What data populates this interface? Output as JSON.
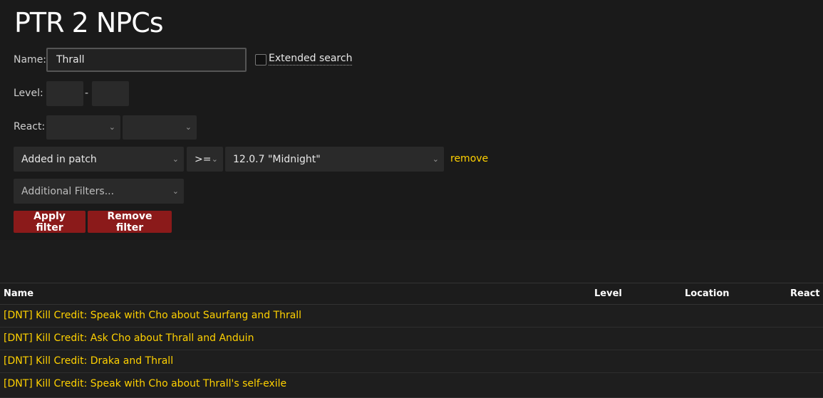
{
  "page": {
    "title": "PTR 2 NPCs"
  },
  "filters": {
    "name_label": "Name:",
    "name_value": "Thrall",
    "extended_search_label": "Extended search",
    "level_label": "Level:",
    "level_min": "",
    "level_max": "",
    "level_separator": "-",
    "react_label": "React:",
    "react_1": "",
    "react_2": "",
    "criteria": {
      "field": "Added in patch",
      "operator": ">=",
      "value": "12.0.7 \"Midnight\"",
      "remove_label": "remove"
    },
    "additional_filters": "Additional Filters...",
    "apply_label": "Apply filter",
    "clear_label": "Remove filter"
  },
  "table": {
    "columns": [
      "Name",
      "Level",
      "Location",
      "React"
    ],
    "rows": [
      {
        "name": "[DNT] Kill Credit: Speak with Cho about Saurfang and Thrall"
      },
      {
        "name": "[DNT] Kill Credit: Ask Cho about Thrall and Anduin"
      },
      {
        "name": "[DNT] Kill Credit: Draka and Thrall"
      },
      {
        "name": "[DNT] Kill Credit: Speak with Cho about Thrall's self-exile"
      }
    ]
  },
  "icons": {
    "dropdown": "chevron-down-icon"
  },
  "colors": {
    "accent_link": "#ffd100",
    "button": "#8b1a1a"
  }
}
